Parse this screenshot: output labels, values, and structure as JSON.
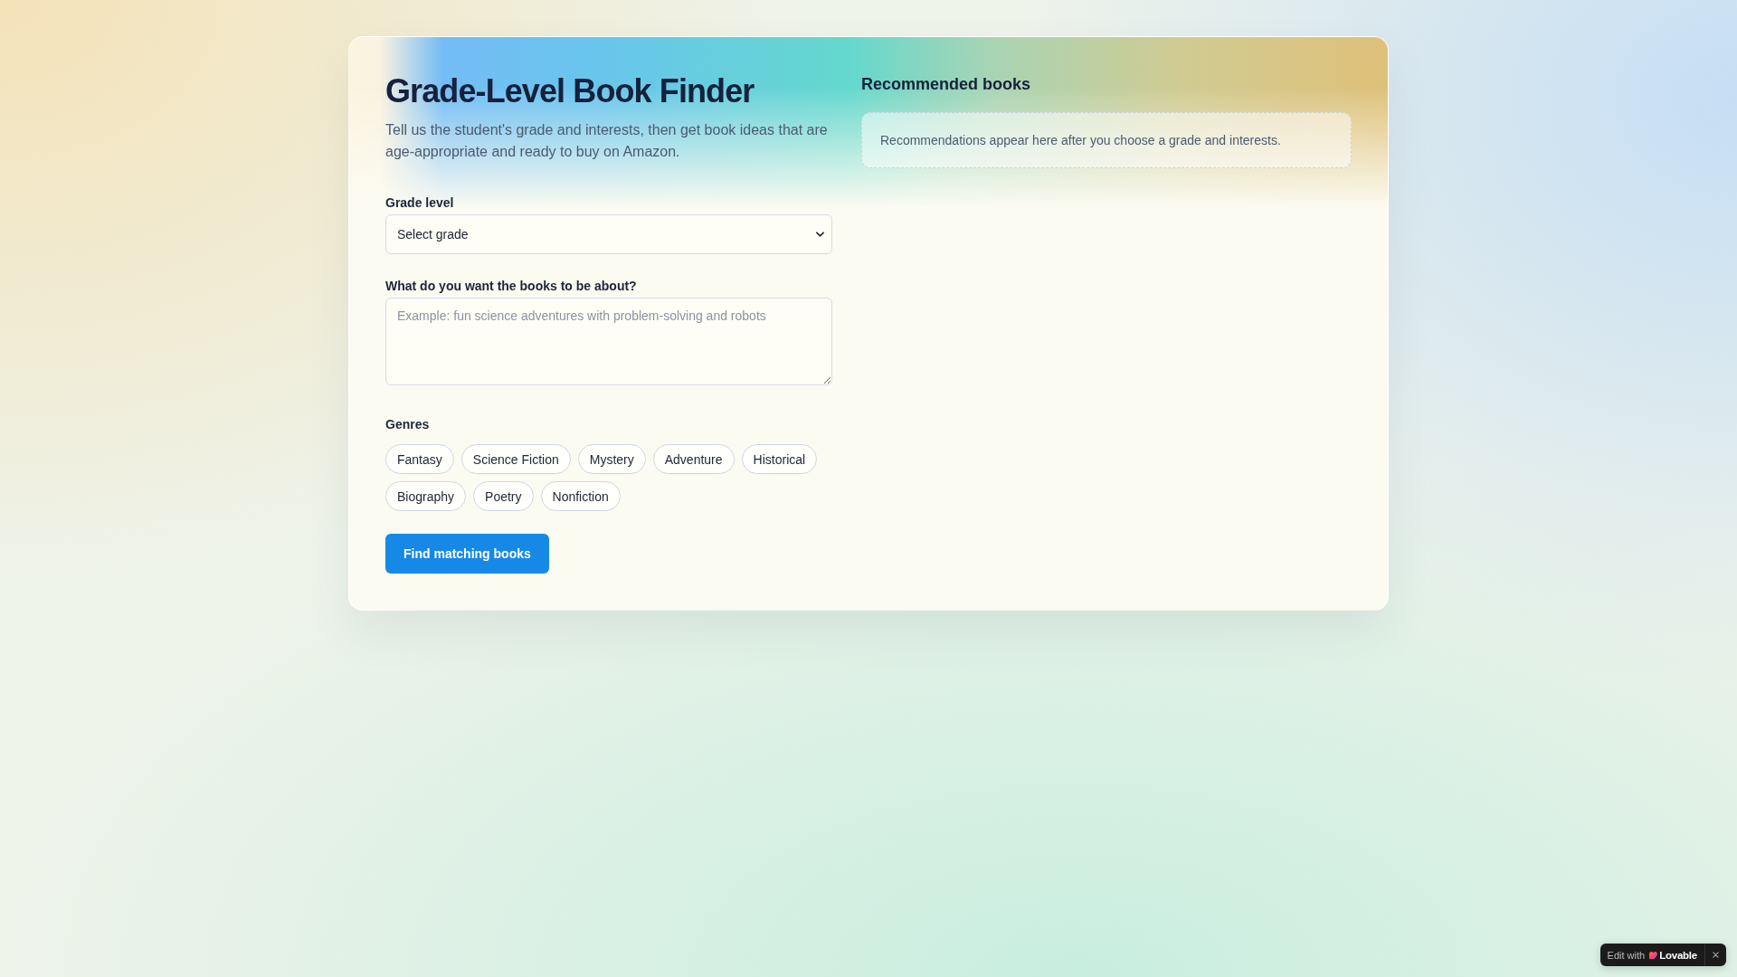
{
  "header": {
    "title": "Grade-Level Book Finder",
    "subtitle": "Tell us the student's grade and interests, then get book ideas that are age-appropriate and ready to buy on Amazon."
  },
  "grade_field": {
    "label": "Grade level",
    "value": "Select grade"
  },
  "topic_field": {
    "label": "What do you want the books to be about?",
    "placeholder": "Example: fun science adventures with problem-solving and robots"
  },
  "genres": {
    "label": "Genres",
    "options": [
      {
        "label": "Fantasy",
        "selected": false
      },
      {
        "label": "Science Fiction",
        "selected": false
      },
      {
        "label": "Mystery",
        "selected": false
      },
      {
        "label": "Adventure",
        "selected": false
      },
      {
        "label": "Historical",
        "selected": false
      },
      {
        "label": "Biography",
        "selected": false
      },
      {
        "label": "Poetry",
        "selected": false
      },
      {
        "label": "Nonfiction",
        "selected": false
      }
    ]
  },
  "submit_button": {
    "label": "Find matching books"
  },
  "recommendations": {
    "title": "Recommended books",
    "empty_message": "Recommendations appear here after you choose a grade and interests."
  },
  "edit_badge": {
    "prefix": "Edit with",
    "brand": "Lovable"
  }
}
